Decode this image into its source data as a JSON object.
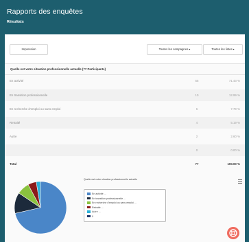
{
  "header": {
    "title": "Rapports des enquêtes",
    "subtitle": "Résultats"
  },
  "toolbar": {
    "print_label": "Impression",
    "campaigns_label": "Toutes les campagnes",
    "lists_label": "Toutes les listes"
  },
  "question": {
    "text": "Quelle est votre situation professionnelle actuelle (77 Participants)"
  },
  "rows": [
    {
      "label": "En activité",
      "count": "55",
      "percent": "71.43 %"
    },
    {
      "label": "En transition professionnelle",
      "count": "10",
      "percent": "12.99 %"
    },
    {
      "label": "En recherche d'emploi ou sans emploi",
      "count": "6",
      "percent": "7.79 %"
    },
    {
      "label": "Retraité",
      "count": "4",
      "percent": "5.19 %"
    },
    {
      "label": "Autre",
      "count": "2",
      "percent": "2.60 %"
    },
    {
      "label": "",
      "count": "0",
      "percent": "0.00 %"
    }
  ],
  "total": {
    "label": "Total",
    "count": "77",
    "percent": "100.00 %"
  },
  "chart": {
    "title": "Quelle est votre situation professionnelle actuelle",
    "legend": [
      {
        "label": "En activité ...",
        "color": "#4a86c8"
      },
      {
        "label": "En transition professionnelle ...",
        "color": "#1c2a3b"
      },
      {
        "label": "En recherche d'emploi ou sans emploi ...",
        "color": "#8ac23e"
      },
      {
        "label": "Retraité ...",
        "color": "#8b1a1a"
      },
      {
        "label": "Autre ...",
        "color": "#2ab0d8"
      },
      {
        "label": "0",
        "color": "#1f3569"
      }
    ]
  },
  "chart_data": {
    "type": "pie",
    "title": "Quelle est votre situation professionnelle actuelle",
    "categories": [
      "En activité",
      "En transition professionnelle",
      "En recherche d'emploi ou sans emploi",
      "Retraité",
      "Autre",
      "0"
    ],
    "values": [
      55,
      10,
      6,
      4,
      2,
      0
    ],
    "colors": [
      "#4a86c8",
      "#1c2a3b",
      "#8ac23e",
      "#8b1a1a",
      "#2ab0d8",
      "#1f3569"
    ],
    "legend": "right"
  },
  "help_icon": "lifebuoy-icon",
  "menu_icon": "hamburger-menu-icon"
}
